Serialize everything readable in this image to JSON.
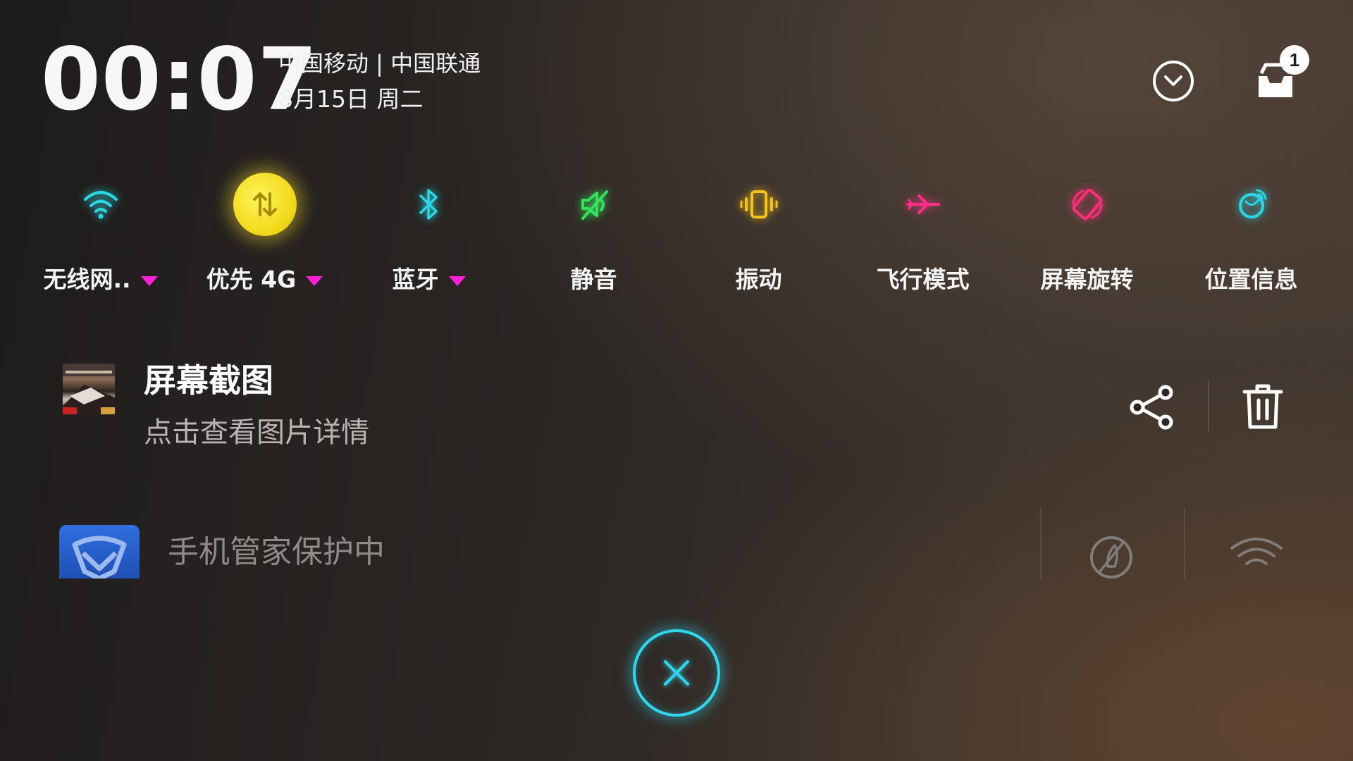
{
  "header": {
    "clock": "00:07",
    "carrier": "中国移动 | 中国联通",
    "date": "8月15日 周二",
    "notification_count": "1"
  },
  "toggles": [
    {
      "label": "无线网..",
      "icon": "wifi-icon",
      "color": "#2bd7e6",
      "dropdown": true,
      "active": false
    },
    {
      "label": "优先 4G",
      "icon": "mobile-data-icon",
      "color": "#f3db20",
      "dropdown": true,
      "active": true
    },
    {
      "label": "蓝牙",
      "icon": "bluetooth-icon",
      "color": "#2bd7e6",
      "dropdown": true,
      "active": false
    },
    {
      "label": "静音",
      "icon": "mute-icon",
      "color": "#35e05a",
      "dropdown": false,
      "active": false
    },
    {
      "label": "振动",
      "icon": "vibrate-icon",
      "color": "#f5c31a",
      "dropdown": false,
      "active": false
    },
    {
      "label": "飞行模式",
      "icon": "airplane-icon",
      "color": "#ff2e8a",
      "dropdown": false,
      "active": false
    },
    {
      "label": "屏幕旋转",
      "icon": "rotate-icon",
      "color": "#ff2e7a",
      "dropdown": false,
      "active": false
    },
    {
      "label": "位置信息",
      "icon": "location-icon",
      "color": "#2bd7e6",
      "dropdown": false,
      "active": false
    }
  ],
  "notifications": {
    "screenshot": {
      "title": "屏幕截图",
      "subtitle": "点击查看图片详情"
    },
    "guard": {
      "text": "手机管家保护中"
    }
  },
  "colors": {
    "dropdown_accent": "#ff1fd6",
    "close_ring": "#2fd8ee"
  }
}
